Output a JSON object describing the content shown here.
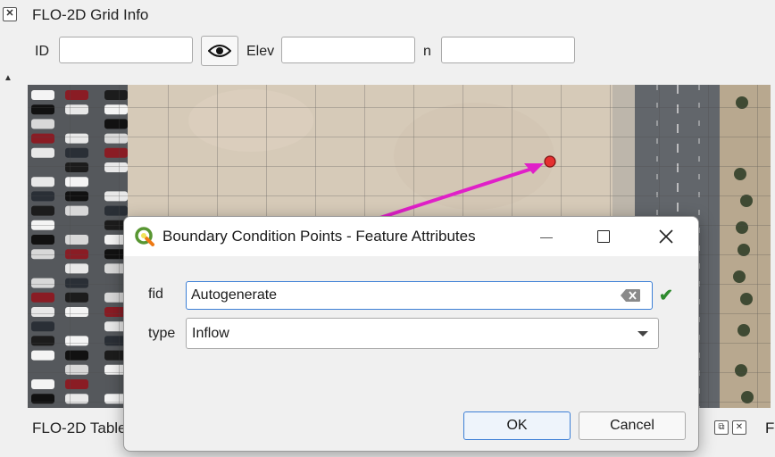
{
  "grid_info": {
    "title": "FLO-2D Grid Info",
    "id_label": "ID",
    "id_value": "",
    "elev_label": "Elev",
    "elev_value": "",
    "n_label": "n",
    "n_value": ""
  },
  "bottom_panel": {
    "title": "FLO-2D Table",
    "right_letter": "F"
  },
  "dialog": {
    "title": "Boundary Condition Points - Feature Attributes",
    "fid_label": "fid",
    "fid_value": "Autogenerate",
    "type_label": "type",
    "type_value": "Inflow",
    "ok_label": "OK",
    "cancel_label": "Cancel"
  },
  "icons": {
    "panel_close": "close-icon",
    "eye": "eye-icon",
    "qgis_logo": "qgis-logo-icon",
    "clear": "clear-text-icon",
    "valid": "checkmark-icon",
    "minimize": "minimize-icon",
    "maximize": "maximize-icon",
    "close": "close-icon",
    "dropdown": "chevron-down-icon"
  },
  "colors": {
    "annotation_arrow": "#e020c8",
    "point_marker": "#e53030",
    "focus_border": "#3c7fd6",
    "valid_check": "#2e8b2e"
  }
}
